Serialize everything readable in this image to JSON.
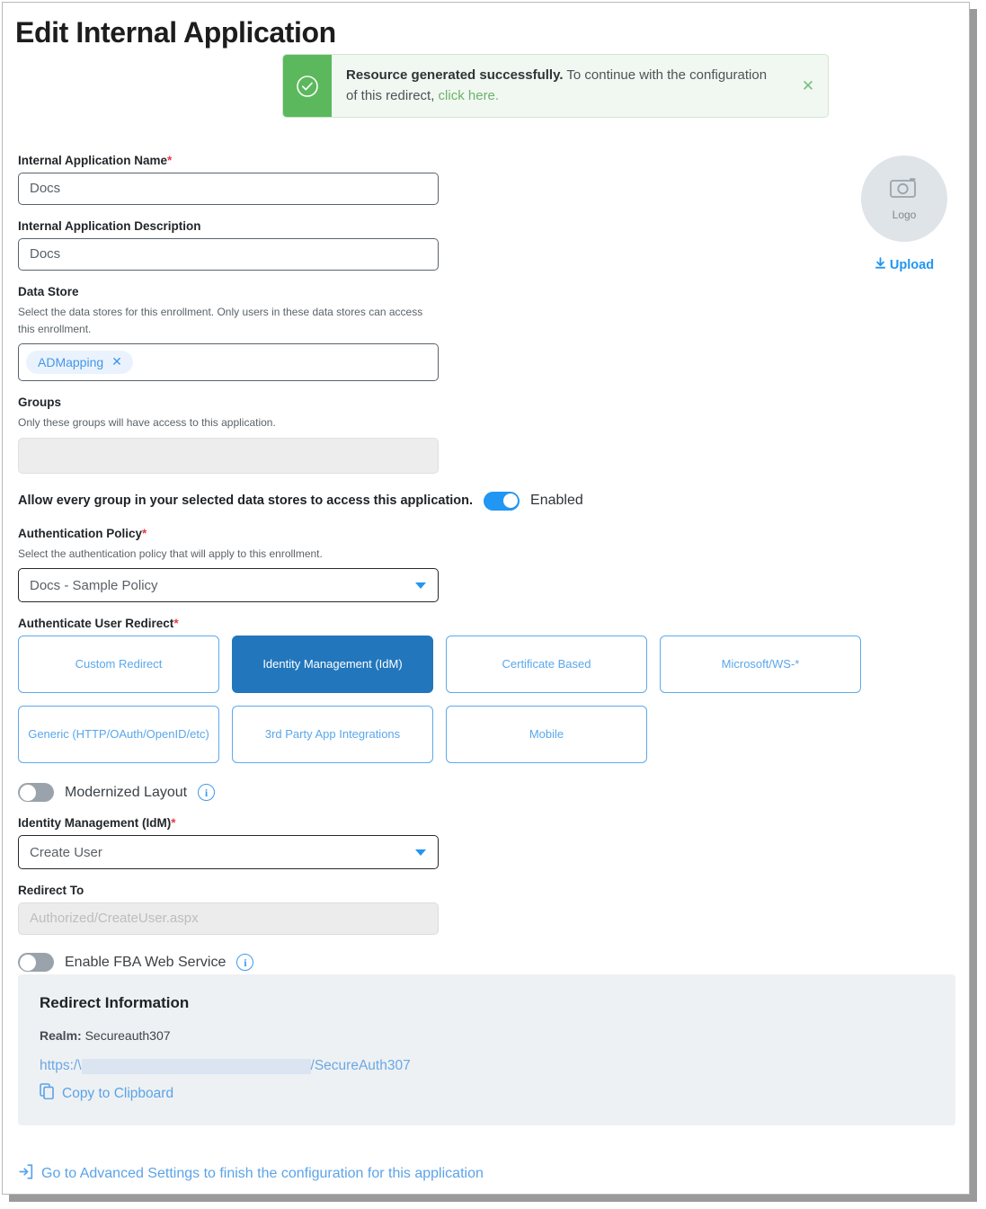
{
  "page": {
    "title": "Edit Internal Application"
  },
  "alert": {
    "icon": "check-circle-icon",
    "strong_text": "Resource generated successfully.",
    "body_text": " To continue with the configuration of this redirect, ",
    "link_text": "click here.",
    "close_label": "✕",
    "accent_color": "#5cb85c",
    "background_color": "#f1f8f1"
  },
  "logo": {
    "placeholder_label": "Logo",
    "icon": "camera-icon",
    "upload_label": "Upload",
    "upload_icon": "download-arrow-icon"
  },
  "form": {
    "app_name": {
      "label": "Internal Application Name",
      "required": true,
      "value": "Docs"
    },
    "app_description": {
      "label": "Internal Application Description",
      "required": false,
      "value": "Docs"
    },
    "data_store": {
      "label": "Data Store",
      "help": "Select the data stores for this enrollment. Only users in these data stores can access this enrollment.",
      "chips": [
        "ADMapping"
      ],
      "chip_remove_icon": "close-icon"
    },
    "groups": {
      "label": "Groups",
      "help": "Only these groups will have access to this application.",
      "value": ""
    },
    "allow_every_group": {
      "label": "Allow every group in your selected data stores to access this application.",
      "state_label": "Enabled",
      "enabled": true
    },
    "auth_policy": {
      "label": "Authentication Policy",
      "required": true,
      "help": "Select the authentication policy that will apply to this enrollment.",
      "value": "Docs - Sample Policy"
    },
    "authenticate_user_redirect": {
      "label": "Authenticate User Redirect",
      "required": true,
      "options": [
        {
          "label": "Custom Redirect",
          "selected": false
        },
        {
          "label": "Identity Management (IdM)",
          "selected": true
        },
        {
          "label": "Certificate Based",
          "selected": false
        },
        {
          "label": "Microsoft/WS-*",
          "selected": false
        },
        {
          "label": "Generic (HTTP/OAuth/OpenID/etc)",
          "selected": false
        },
        {
          "label": "3rd Party App Integrations",
          "selected": false
        },
        {
          "label": "Mobile",
          "selected": false
        }
      ],
      "selected_color": "#2277bc",
      "unselected_color": "#5aa7ea"
    },
    "modernized_layout": {
      "label": "Modernized Layout",
      "enabled": false,
      "info_icon": "info-icon"
    },
    "idm": {
      "label": "Identity Management (IdM)",
      "required": true,
      "value": "Create User"
    },
    "redirect_to": {
      "label": "Redirect To",
      "placeholder": "Authorized/CreateUser.aspx",
      "value": "",
      "readonly": true
    },
    "fba_web_service": {
      "label": "Enable FBA Web Service",
      "enabled": false,
      "info_icon": "info-icon"
    }
  },
  "redirect_information": {
    "heading": "Redirect Information",
    "realm_key": "Realm:",
    "realm_value": "Secureauth307",
    "url_prefix": "https:/\\",
    "url_suffix": "/SecureAuth307",
    "copy_label": "Copy to Clipboard",
    "copy_icon": "copy-icon"
  },
  "advanced_settings": {
    "icon": "enter-arrow-icon",
    "label": "Go to Advanced Settings to finish the configuration for this application"
  }
}
